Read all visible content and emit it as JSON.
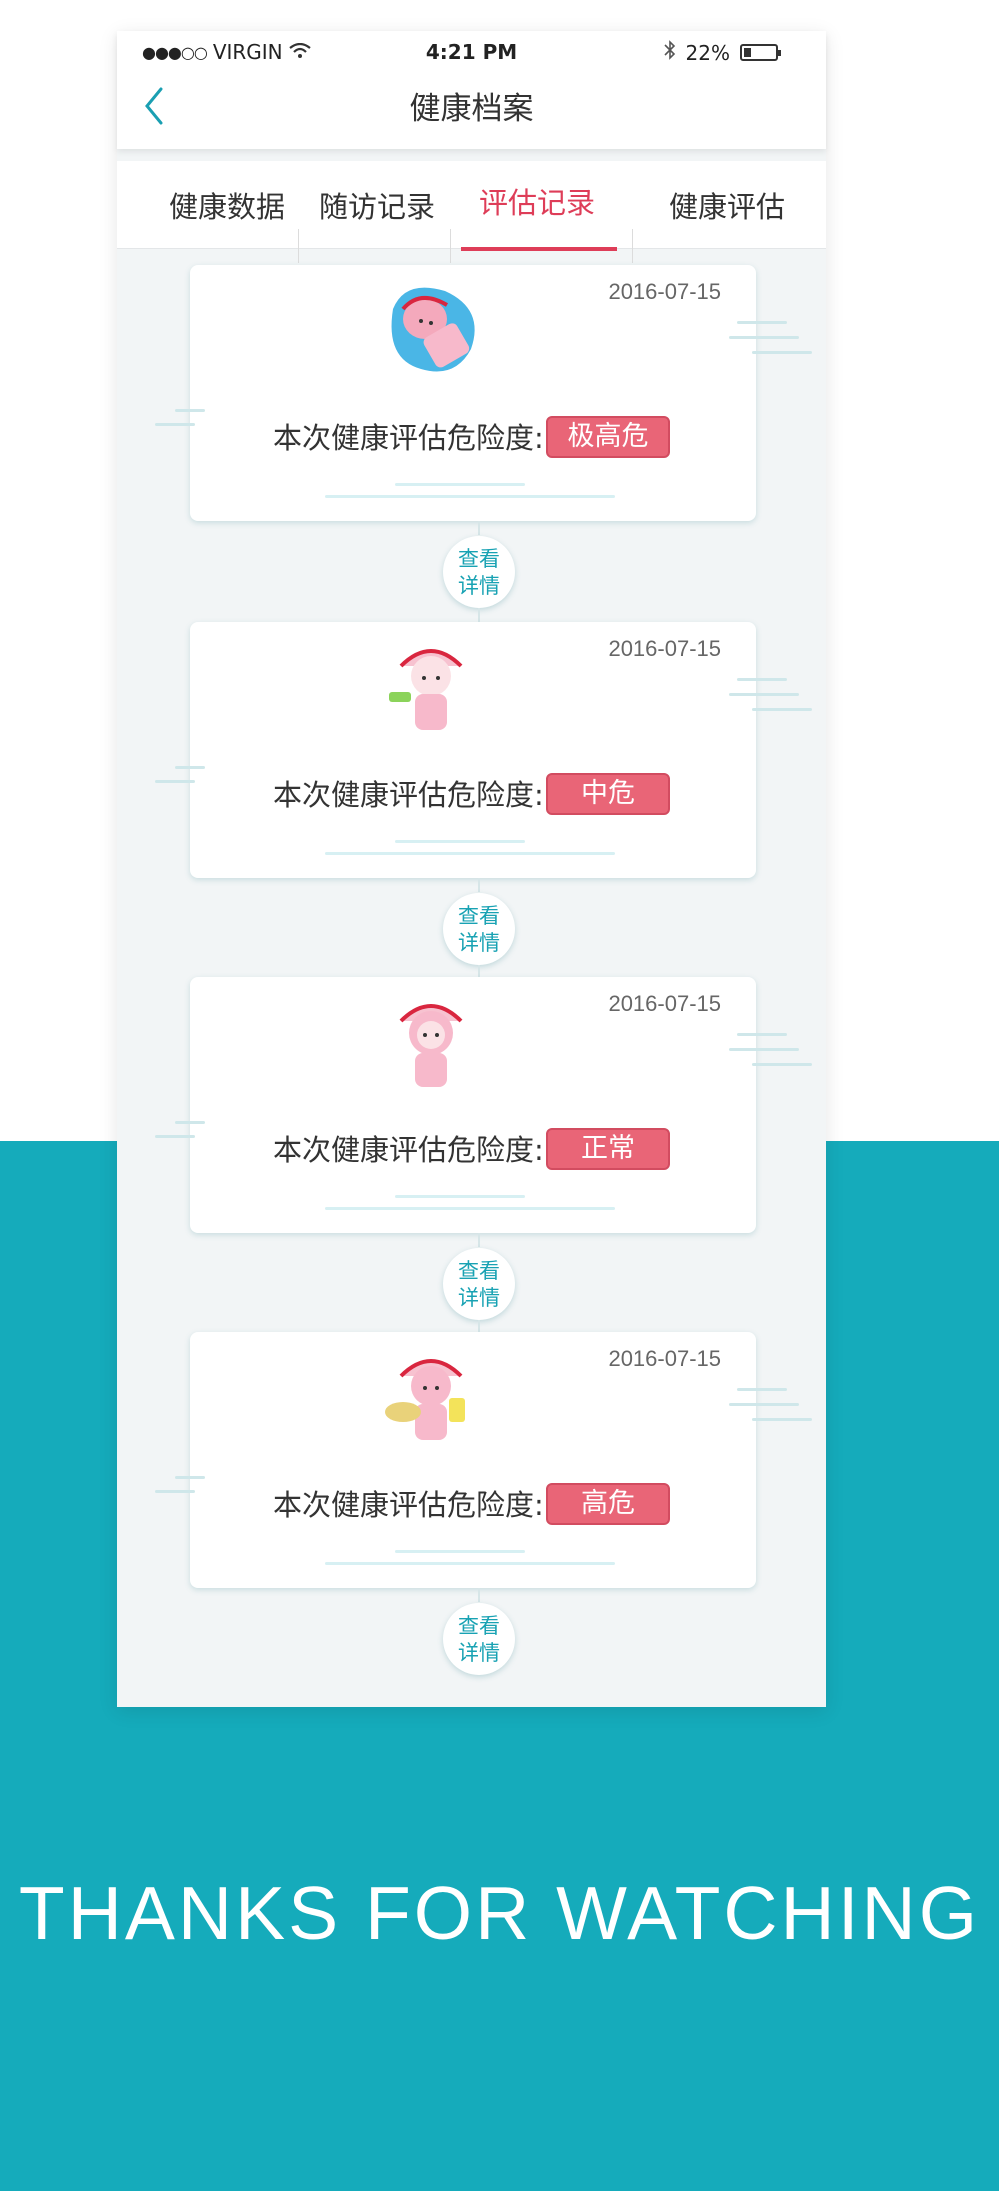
{
  "status_bar": {
    "signal_dots": "●●●○○",
    "carrier": "VIRGIN",
    "time": "4:21 PM",
    "battery": "22%"
  },
  "nav": {
    "title": "健康档案"
  },
  "tabs": [
    {
      "label": "健康数据"
    },
    {
      "label": "随访记录"
    },
    {
      "label": "评估记录",
      "active": true
    },
    {
      "label": "健康评估"
    }
  ],
  "records": [
    {
      "date": "2016-07-15",
      "label": "本次健康评估危险度:",
      "risk": "极高危",
      "detail": "查看\n详情"
    },
    {
      "date": "2016-07-15",
      "label": "本次健康评估危险度:",
      "risk": "中危",
      "detail": "查看\n详情"
    },
    {
      "date": "2016-07-15",
      "label": "本次健康评估危险度:",
      "risk": "正常",
      "detail": "查看\n详情"
    },
    {
      "date": "2016-07-15",
      "label": "本次健康评估危险度:",
      "risk": "高危",
      "detail": "查看\n详情"
    }
  ],
  "footer": {
    "thanks": "THANKS FOR WATCHING"
  },
  "colors": {
    "accent": "#de3d58",
    "teal": "#15abbb",
    "badge": "#e96577"
  }
}
